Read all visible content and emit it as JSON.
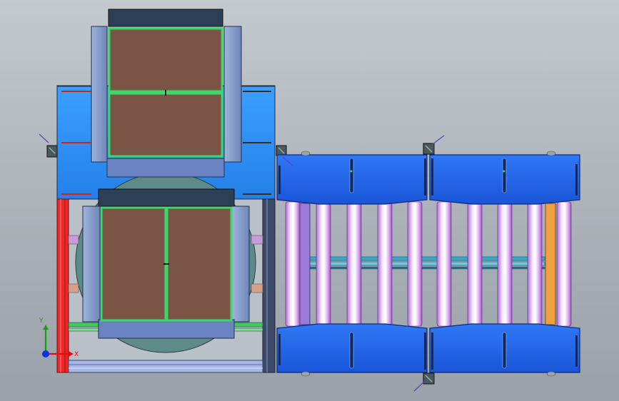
{
  "viewport": {
    "background_top": "#c4c9ce",
    "background_bottom": "#9aa1a9"
  },
  "triad": {
    "x_label": "X",
    "y_label": "Y",
    "x_color": "#e01010",
    "y_color": "#10a010",
    "z_color": "#1030e0"
  },
  "colors": {
    "conveyor_blue": "#1c5fe8",
    "frame_blue": "#2a8cf0",
    "box_brown": "#7a5444",
    "box_edge_green": "#3ad86a",
    "roller_glow": "#f3e6ff",
    "turntable_teal": "#5e8a8a",
    "frame_red": "#e8282a",
    "plate_grey": "#8aa0c6"
  },
  "icons": [
    "coordinate-triad-icon",
    "corner-bracket-icon"
  ]
}
